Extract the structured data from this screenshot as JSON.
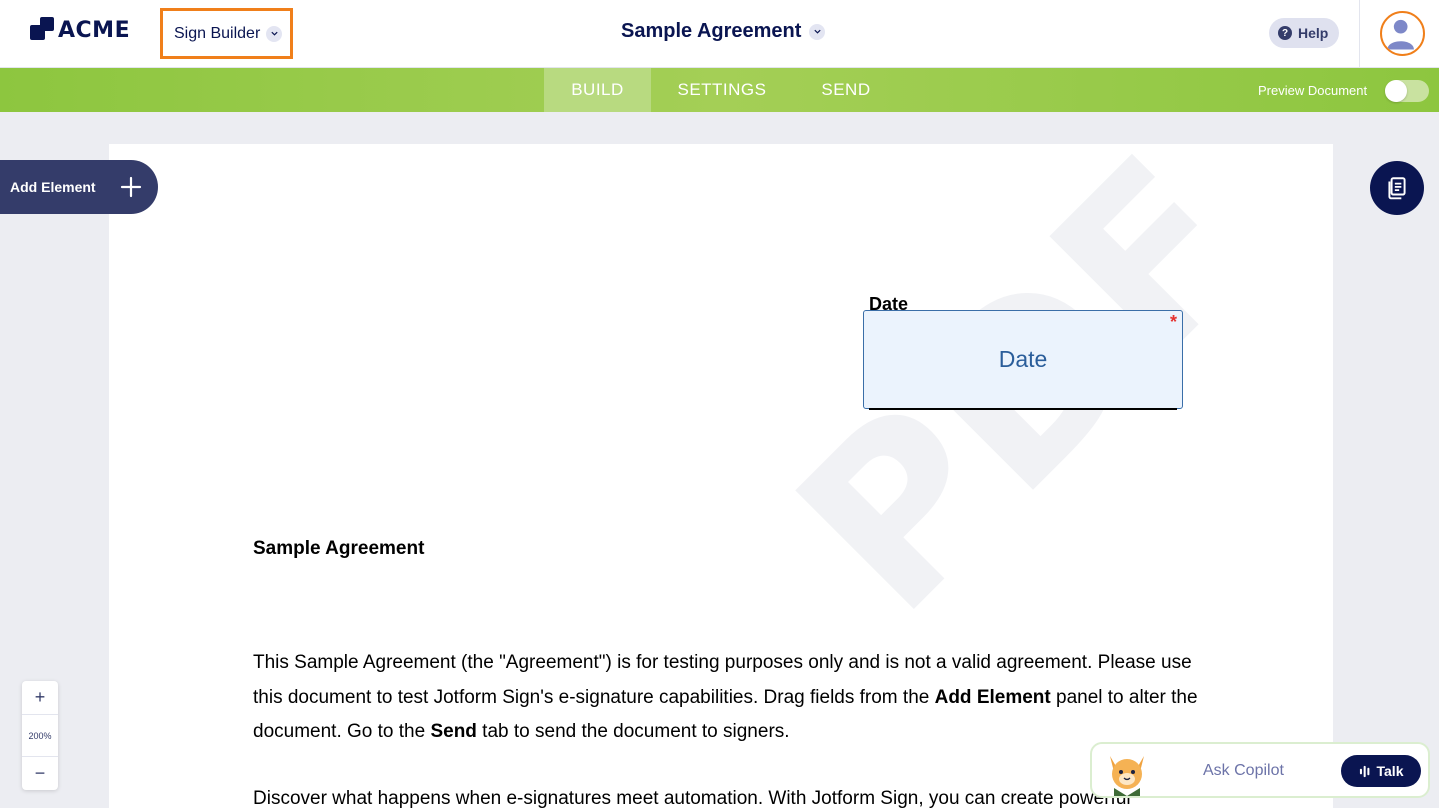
{
  "header": {
    "logo_text": "ACME",
    "builder_label": "Sign Builder",
    "document_title": "Sample Agreement",
    "help_label": "Help"
  },
  "nav": {
    "tabs": [
      {
        "label": "BUILD",
        "active": true
      },
      {
        "label": "SETTINGS",
        "active": false
      },
      {
        "label": "SEND",
        "active": false
      }
    ],
    "preview_label": "Preview Document",
    "preview_enabled": false
  },
  "sidebar": {
    "add_element_label": "Add Element"
  },
  "document": {
    "watermark": "PDF",
    "date_label": "Date",
    "date_field_text": "Date",
    "required_marker": "*",
    "agreement_title": "Sample Agreement",
    "paragraph1": {
      "part1": "This Sample Agreement (the \"Agreement\") is for testing purposes only and is not a valid agreement. Please use this document to test Jotform Sign's e-signature capabilities. Drag fields from the ",
      "bold1": "Add Element",
      "part2": " panel to alter the document. Go to the ",
      "bold2": "Send",
      "part3": " tab to send the document to signers."
    },
    "paragraph2": "Discover what happens when e-signatures meet automation. With Jotform Sign, you can create powerful"
  },
  "zoom": {
    "plus": "+",
    "level": "200%",
    "minus": "−"
  },
  "copilot": {
    "ask_label": "Ask Copilot",
    "talk_label": "Talk"
  },
  "colors": {
    "navy": "#0a1551",
    "green": "#8dc63f",
    "orange_highlight": "#f07f1a",
    "date_field_bg": "#ebf3fd"
  }
}
